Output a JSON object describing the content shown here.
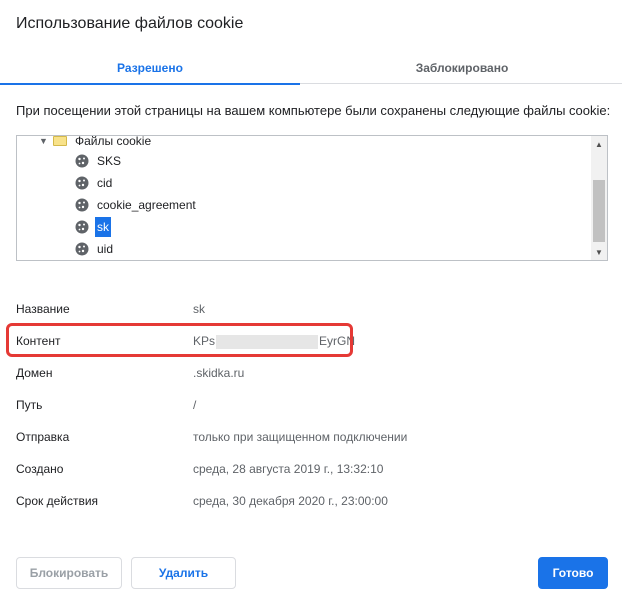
{
  "dialog": {
    "title": "Использование файлов cookie"
  },
  "tabs": [
    {
      "label": "Разрешено",
      "active": true
    },
    {
      "label": "Заблокировано",
      "active": false
    }
  ],
  "intro_text": "При посещении этой страницы на вашем компьютере были сохранены следующие файлы cookie:",
  "tree": {
    "folder_label": "Файлы cookie",
    "items": [
      {
        "label": "SKS",
        "selected": false
      },
      {
        "label": "cid",
        "selected": false
      },
      {
        "label": "cookie_agreement",
        "selected": false
      },
      {
        "label": "sk",
        "selected": true
      },
      {
        "label": "uid",
        "selected": false
      }
    ]
  },
  "details": {
    "name": {
      "key": "Название",
      "value": "sk"
    },
    "content": {
      "key": "Контент",
      "value_prefix": "KPs",
      "value_suffix": "EyrGN"
    },
    "domain": {
      "key": "Домен",
      "value": ".skidka.ru"
    },
    "path": {
      "key": "Путь",
      "value": "/"
    },
    "send": {
      "key": "Отправка",
      "value": "только при защищенном подключении"
    },
    "created": {
      "key": "Создано",
      "value": "среда, 28 августа 2019 г., 13:32:10"
    },
    "expires": {
      "key": "Срок действия",
      "value": "среда, 30 декабря 2020 г., 23:00:00"
    }
  },
  "buttons": {
    "block": "Блокировать",
    "delete": "Удалить",
    "done": "Готово"
  },
  "colors": {
    "accent": "#1a73e8",
    "highlight_border": "#e53935"
  }
}
